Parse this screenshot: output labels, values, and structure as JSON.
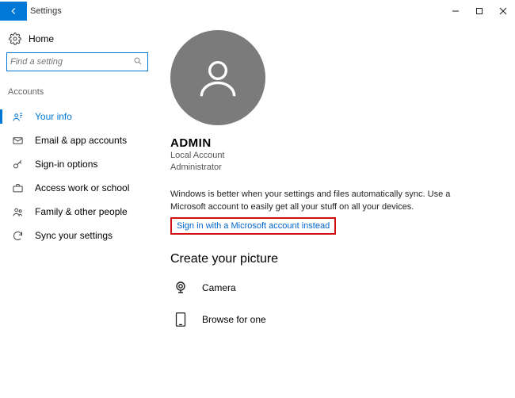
{
  "window": {
    "title": "Settings"
  },
  "sidebar": {
    "home": "Home",
    "search_placeholder": "Find a setting",
    "section": "Accounts",
    "items": [
      {
        "label": "Your info"
      },
      {
        "label": "Email & app accounts"
      },
      {
        "label": "Sign-in options"
      },
      {
        "label": "Access work or school"
      },
      {
        "label": "Family & other people"
      },
      {
        "label": "Sync your settings"
      }
    ]
  },
  "profile": {
    "name": "ADMIN",
    "account_type": "Local Account",
    "role": "Administrator",
    "body": "Windows is better when your settings and files automatically sync. Use a Microsoft account to easily get all your stuff on all your devices.",
    "signin_link": "Sign in with a Microsoft account instead"
  },
  "picture": {
    "heading": "Create your picture",
    "camera": "Camera",
    "browse": "Browse for one"
  }
}
